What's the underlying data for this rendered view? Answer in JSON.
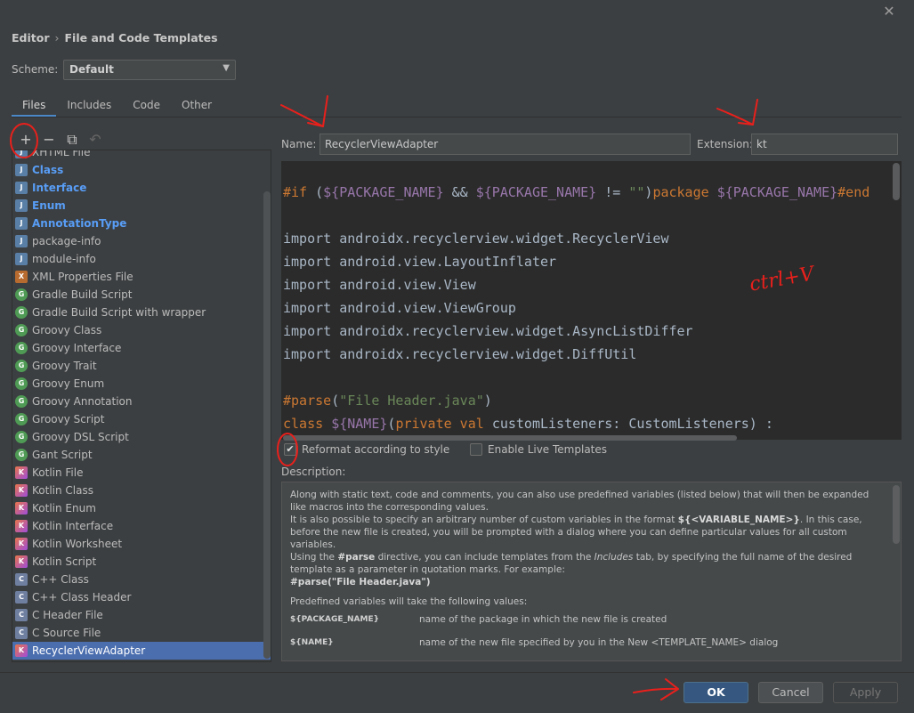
{
  "window": {
    "close_glyph": "✕"
  },
  "breadcrumb": {
    "section": "Editor",
    "separator": "›",
    "page": "File and Code Templates"
  },
  "scheme": {
    "label": "Scheme:",
    "value": "Default"
  },
  "tabs": [
    {
      "label": "Files",
      "active": true
    },
    {
      "label": "Includes",
      "active": false
    },
    {
      "label": "Code",
      "active": false
    },
    {
      "label": "Other",
      "active": false
    }
  ],
  "toolbar": {
    "add": "+",
    "remove": "−",
    "copy": "⧉",
    "reset": "↶"
  },
  "templates": [
    {
      "label": "XHTML File",
      "icon": "java-file-icon",
      "style": "normal"
    },
    {
      "label": "Class",
      "icon": "java-file-icon",
      "style": "blue"
    },
    {
      "label": "Interface",
      "icon": "java-file-icon",
      "style": "blue"
    },
    {
      "label": "Enum",
      "icon": "java-file-icon",
      "style": "blue"
    },
    {
      "label": "AnnotationType",
      "icon": "java-file-icon",
      "style": "blue"
    },
    {
      "label": "package-info",
      "icon": "java-file-icon",
      "style": "bold"
    },
    {
      "label": "module-info",
      "icon": "java-file-icon",
      "style": "bold"
    },
    {
      "label": "XML Properties File",
      "icon": "xml-file-icon",
      "style": "normal"
    },
    {
      "label": "Gradle Build Script",
      "icon": "groovy-icon",
      "style": "bold"
    },
    {
      "label": "Gradle Build Script with wrapper",
      "icon": "groovy-icon",
      "style": "bold"
    },
    {
      "label": "Groovy Class",
      "icon": "groovy-icon",
      "style": "bold"
    },
    {
      "label": "Groovy Interface",
      "icon": "groovy-icon",
      "style": "bold"
    },
    {
      "label": "Groovy Trait",
      "icon": "groovy-icon",
      "style": "bold"
    },
    {
      "label": "Groovy Enum",
      "icon": "groovy-icon",
      "style": "bold"
    },
    {
      "label": "Groovy Annotation",
      "icon": "groovy-icon",
      "style": "bold"
    },
    {
      "label": "Groovy Script",
      "icon": "groovy-icon",
      "style": "bold"
    },
    {
      "label": "Groovy DSL Script",
      "icon": "groovy-icon",
      "style": "bold"
    },
    {
      "label": "Gant Script",
      "icon": "groovy-icon",
      "style": "bold"
    },
    {
      "label": "Kotlin File",
      "icon": "kotlin-icon",
      "style": "bold"
    },
    {
      "label": "Kotlin Class",
      "icon": "kotlin-icon",
      "style": "bold"
    },
    {
      "label": "Kotlin Enum",
      "icon": "kotlin-icon",
      "style": "bold"
    },
    {
      "label": "Kotlin Interface",
      "icon": "kotlin-icon",
      "style": "bold"
    },
    {
      "label": "Kotlin Worksheet",
      "icon": "kotlin-icon",
      "style": "bold"
    },
    {
      "label": "Kotlin Script",
      "icon": "kotlin-icon",
      "style": "bold"
    },
    {
      "label": "C++ Class",
      "icon": "cpp-icon",
      "style": "bold"
    },
    {
      "label": "C++ Class Header",
      "icon": "cpp-icon",
      "style": "bold"
    },
    {
      "label": "C Header File",
      "icon": "cpp-icon",
      "style": "bold"
    },
    {
      "label": "C Source File",
      "icon": "cpp-icon",
      "style": "bold"
    },
    {
      "label": "RecyclerViewAdapter",
      "icon": "kotlin-icon",
      "style": "selected"
    }
  ],
  "form": {
    "name_label": "Name:",
    "name_value": "RecyclerViewAdapter",
    "ext_label": "Extension:",
    "ext_value": "kt"
  },
  "code_lines": [
    [
      [
        "kw",
        "#if "
      ],
      [
        "p",
        "("
      ],
      [
        "vr",
        "${PACKAGE_NAME}"
      ],
      [
        "p",
        " && "
      ],
      [
        "vr",
        "${PACKAGE_NAME}"
      ],
      [
        "p",
        " != "
      ],
      [
        "str",
        "\"\""
      ],
      [
        "p",
        ")"
      ],
      [
        "kw",
        "package "
      ],
      [
        "vr",
        "${PACKAGE_NAME}"
      ],
      [
        "kw",
        "#end"
      ]
    ],
    [],
    [
      [
        "p",
        "import androidx.recyclerview.widget.RecyclerView"
      ]
    ],
    [
      [
        "p",
        "import android.view.LayoutInflater"
      ]
    ],
    [
      [
        "p",
        "import android.view.View"
      ]
    ],
    [
      [
        "p",
        "import android.view.ViewGroup"
      ]
    ],
    [
      [
        "p",
        "import androidx.recyclerview.widget.AsyncListDiffer"
      ]
    ],
    [
      [
        "p",
        "import androidx.recyclerview.widget.DiffUtil"
      ]
    ],
    [],
    [
      [
        "kw",
        "#parse"
      ],
      [
        "p",
        "("
      ],
      [
        "str",
        "\"File Header.java\""
      ],
      [
        "p",
        ")"
      ]
    ],
    [
      [
        "kw",
        "class "
      ],
      [
        "vr",
        "${NAME}"
      ],
      [
        "p",
        "("
      ],
      [
        "kw",
        "private val "
      ],
      [
        "p",
        "customListeners: CustomListeners) :"
      ]
    ]
  ],
  "options": {
    "reformat_label": "Reformat according to style",
    "reformat_checked": true,
    "live_label": "Enable Live Templates",
    "live_checked": false
  },
  "description": {
    "label": "Description:",
    "para1": "Along with static text, code and comments, you can also use predefined variables (listed below) that will then be expanded like macros into the corresponding values.",
    "para2a": "It is also possible to specify an arbitrary number of custom variables in the format ",
    "para2b": "${<VARIABLE_NAME>}",
    "para2c": ". In this case, before the new file is created, you will be prompted with a dialog where you can define particular values for all custom variables.",
    "para3a": "Using the ",
    "para3b": "#parse",
    "para3c": " directive, you can include templates from the ",
    "para3d": "Includes",
    "para3e": " tab, by specifying the full name of the desired template as a parameter in quotation marks. For example:",
    "para4": "#parse(\"File Header.java\")",
    "para5": "Predefined variables will take the following values:",
    "vars": [
      {
        "name": "${PACKAGE_NAME}",
        "text": "name of the package in which the new file is created"
      },
      {
        "name": "${NAME}",
        "text": "name of the new file specified by you in the New <TEMPLATE_NAME> dialog"
      }
    ]
  },
  "buttons": {
    "ok": "OK",
    "cancel": "Cancel",
    "apply": "Apply"
  },
  "annotation": {
    "shortcut_text": "ctrl+V",
    "color": "#e8201c"
  },
  "colors": {
    "accent": "#4b6eaf",
    "ok": "#365880",
    "background": "#3c3f41",
    "editor": "#2b2b2b"
  }
}
